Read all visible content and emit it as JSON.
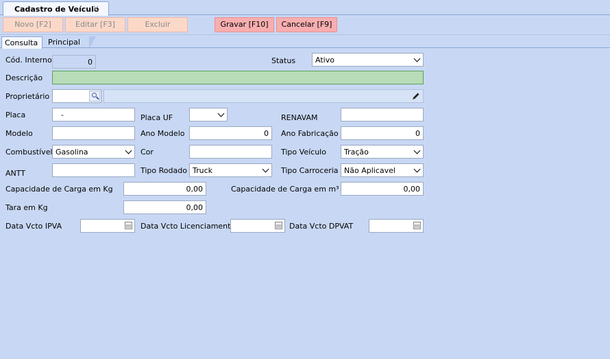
{
  "doc_tab": {
    "title": "Cadastro de Veículo",
    "close": "×"
  },
  "toolbar": {
    "novo": "Novo [F2]",
    "editar": "Editar [F3]",
    "excluir": "Excluir",
    "gravar": "Gravar [F10]",
    "cancelar": "Cancelar [F9]"
  },
  "subtabs": {
    "consulta": "Consulta",
    "principal": "Principal"
  },
  "form": {
    "cod_interno": {
      "label": "Cód. Interno",
      "value": "0"
    },
    "status": {
      "label": "Status",
      "value": "Ativo"
    },
    "descricao": {
      "label": "Descrição",
      "value": ""
    },
    "proprietario": {
      "label": "Proprietário",
      "value": ""
    },
    "placa": {
      "label": "Placa",
      "value": "-"
    },
    "placa_uf": {
      "label": "Placa UF",
      "value": ""
    },
    "renavam": {
      "label": "RENAVAM",
      "value": ""
    },
    "modelo": {
      "label": "Modelo",
      "value": ""
    },
    "ano_modelo": {
      "label": "Ano Modelo",
      "value": "0"
    },
    "ano_fabricacao": {
      "label": "Ano Fabricação",
      "value": "0"
    },
    "combustivel": {
      "label": "Combustível",
      "value": "Gasolina"
    },
    "cor": {
      "label": "Cor",
      "value": ""
    },
    "tipo_veiculo": {
      "label": "Tipo Veículo",
      "value": "Tração"
    },
    "antt": {
      "label": "ANTT",
      "value": ""
    },
    "tipo_rodado": {
      "label": "Tipo Rodado",
      "value": "Truck"
    },
    "tipo_carroceria": {
      "label": "Tipo Carroceria",
      "value": "Não Aplicavel"
    },
    "cap_kg": {
      "label": "Capacidade de Carga em Kg",
      "value": "0,00"
    },
    "cap_m3": {
      "label": "Capacidade de Carga em m³",
      "value": "0,00"
    },
    "tara": {
      "label": "Tara em Kg",
      "value": "0,00"
    },
    "vcto_ipva": {
      "label": "Data Vcto IPVA",
      "value": ""
    },
    "vcto_licenciamento": {
      "label": "Data Vcto Licenciamento",
      "value": ""
    },
    "vcto_dpvat": {
      "label": "Data Vcto DPVAT",
      "value": ""
    }
  }
}
